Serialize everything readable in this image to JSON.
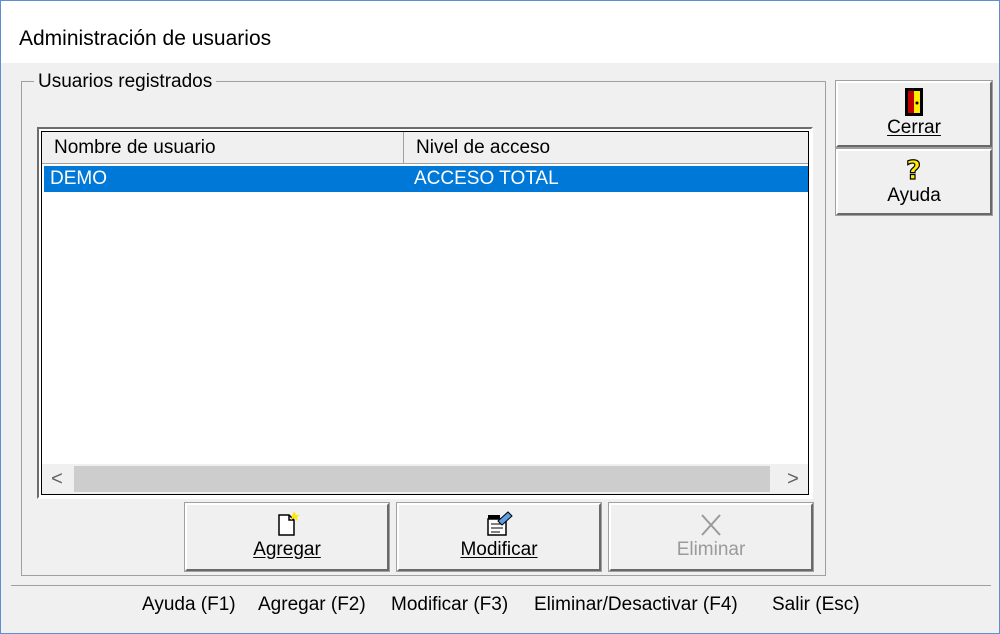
{
  "window": {
    "title": "Administración de usuarios"
  },
  "group": {
    "label": "Usuarios registrados"
  },
  "table": {
    "columns": [
      "Nombre de usuario",
      "Nivel de acceso"
    ],
    "rows": [
      {
        "user": "DEMO",
        "level": "ACCESO TOTAL",
        "selected": true
      }
    ]
  },
  "scroll": {
    "left_arrow": "<",
    "right_arrow": ">"
  },
  "side_buttons": {
    "close": {
      "label": "Cerrar",
      "icon": "exit-door-icon"
    },
    "help": {
      "label": "Ayuda",
      "icon": "question-mark-icon"
    }
  },
  "action_buttons": {
    "add": {
      "label": "Agregar",
      "icon": "new-document-icon"
    },
    "modify": {
      "label": "Modificar",
      "icon": "edit-form-icon"
    },
    "delete": {
      "label": "Eliminar",
      "icon": "delete-x-icon",
      "enabled": false
    }
  },
  "statusbar": {
    "help": "Ayuda (F1)",
    "add": "Agregar (F2)",
    "modify": "Modificar (F3)",
    "delete": "Eliminar/Desactivar (F4)",
    "exit": "Salir (Esc)"
  },
  "colors": {
    "selection": "#0078d7",
    "selection_text": "#ffffff",
    "icon_yellow": "#ffea00"
  }
}
